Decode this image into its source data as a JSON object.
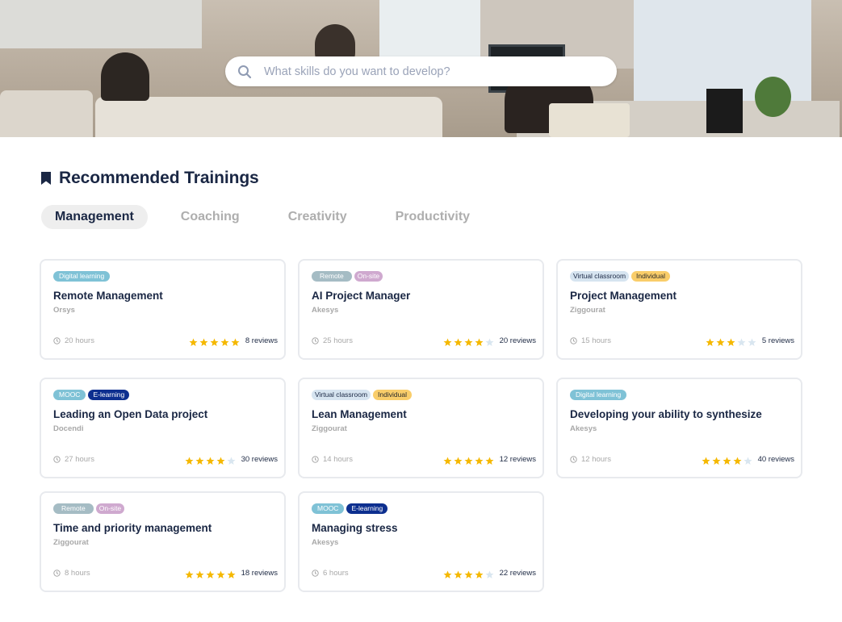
{
  "search": {
    "placeholder": "What skills do you want to develop?",
    "value": ""
  },
  "section": {
    "title": "Recommended Trainings",
    "icon": "bookmark-icon"
  },
  "tabs": [
    {
      "label": "Management",
      "active": true
    },
    {
      "label": "Coaching",
      "active": false
    },
    {
      "label": "Creativity",
      "active": false
    },
    {
      "label": "Productivity",
      "active": false
    }
  ],
  "colors": {
    "star_filled": "#f5b800",
    "star_empty": "#d9e6f0",
    "title": "#1a2744",
    "muted": "#a8a8a8"
  },
  "trainings": [
    {
      "badges": [
        {
          "label": "Digital learning",
          "type": "digital"
        }
      ],
      "title": "Remote Management",
      "provider": "Orsys",
      "duration": "20 hours",
      "rating": 5,
      "reviews": "8 reviews"
    },
    {
      "badges": [
        {
          "label": "Remote",
          "type": "remote"
        },
        {
          "label": "On-site",
          "type": "onsite"
        }
      ],
      "title": "AI Project Manager",
      "provider": "Akesys",
      "duration": "25 hours",
      "rating": 4,
      "reviews": "20 reviews"
    },
    {
      "badges": [
        {
          "label": "Virtual classroom",
          "type": "virtual"
        },
        {
          "label": "Individual",
          "type": "individual"
        }
      ],
      "title": "Project Management",
      "provider": "Ziggourat",
      "duration": "15 hours",
      "rating": 3,
      "reviews": "5 reviews"
    },
    {
      "badges": [
        {
          "label": "MOOC",
          "type": "mooc"
        },
        {
          "label": "E-learning",
          "type": "elearning"
        }
      ],
      "title": "Leading an Open Data project",
      "provider": "Docendi",
      "duration": "27 hours",
      "rating": 4,
      "reviews": "30 reviews"
    },
    {
      "badges": [
        {
          "label": "Virtual classroom",
          "type": "virtual"
        },
        {
          "label": "Individual",
          "type": "individual"
        }
      ],
      "title": "Lean Management",
      "provider": "Ziggourat",
      "duration": "14 hours",
      "rating": 5,
      "reviews": "12 reviews"
    },
    {
      "badges": [
        {
          "label": "Digital learning",
          "type": "digital"
        }
      ],
      "title": "Developing your ability to synthesize",
      "provider": "Akesys",
      "duration": "12 hours",
      "rating": 4,
      "reviews": "40 reviews"
    },
    {
      "badges": [
        {
          "label": "Remote",
          "type": "remote"
        },
        {
          "label": "On-site",
          "type": "onsite"
        }
      ],
      "title": "Time and priority management",
      "provider": "Ziggourat",
      "duration": "8 hours",
      "rating": 5,
      "reviews": "18 reviews"
    },
    {
      "badges": [
        {
          "label": "MOOC",
          "type": "mooc"
        },
        {
          "label": "E-learning",
          "type": "elearning"
        }
      ],
      "title": "Managing stress",
      "provider": "Akesys",
      "duration": "6 hours",
      "rating": 4,
      "reviews": "22 reviews"
    }
  ]
}
